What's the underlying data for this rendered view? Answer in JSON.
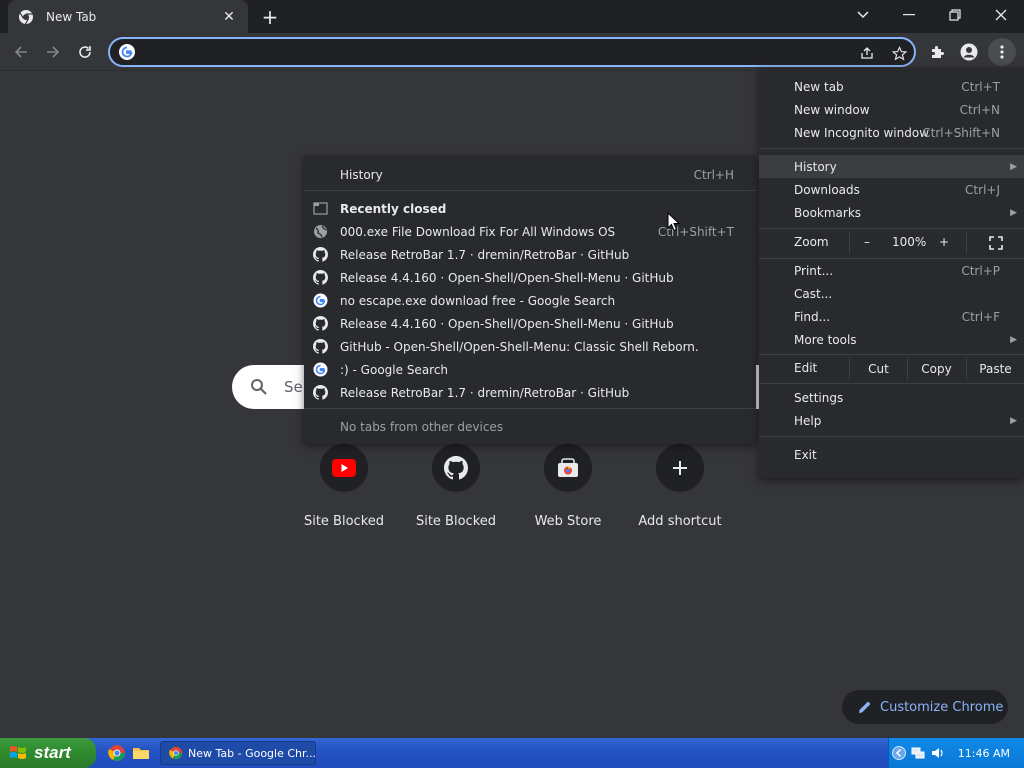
{
  "tab": {
    "title": "New Tab",
    "close": "✕"
  },
  "window": {
    "newtab": "+",
    "dropdown": "⌄",
    "minimize": "—",
    "restore": "❐",
    "close": "✕"
  },
  "omnibox": {
    "value": "",
    "placeholder": ""
  },
  "ntp": {
    "search_placeholder": "Se",
    "shortcuts": [
      {
        "label": "Site Blocked",
        "icon": "youtube-icon"
      },
      {
        "label": "Site Blocked",
        "icon": "github-icon"
      },
      {
        "label": "Web Store",
        "icon": "web-store-icon"
      },
      {
        "label": "Add shortcut",
        "icon": "plus-icon"
      }
    ],
    "customize_label": "Customize Chrome"
  },
  "menu": {
    "new_tab": {
      "label": "New tab",
      "shortcut": "Ctrl+T"
    },
    "new_window": {
      "label": "New window",
      "shortcut": "Ctrl+N"
    },
    "new_incognito": {
      "label": "New Incognito window",
      "shortcut": "Ctrl+Shift+N"
    },
    "history": {
      "label": "History"
    },
    "downloads": {
      "label": "Downloads",
      "shortcut": "Ctrl+J"
    },
    "bookmarks": {
      "label": "Bookmarks"
    },
    "zoom": {
      "label": "Zoom",
      "minus": "–",
      "value": "100%",
      "plus": "+"
    },
    "print": {
      "label": "Print...",
      "shortcut": "Ctrl+P"
    },
    "cast": {
      "label": "Cast..."
    },
    "find": {
      "label": "Find...",
      "shortcut": "Ctrl+F"
    },
    "more_tools": {
      "label": "More tools"
    },
    "edit": {
      "label": "Edit",
      "cut": "Cut",
      "copy": "Copy",
      "paste": "Paste"
    },
    "settings": {
      "label": "Settings"
    },
    "help": {
      "label": "Help"
    },
    "exit": {
      "label": "Exit"
    }
  },
  "history_menu": {
    "history": {
      "label": "History",
      "shortcut": "Ctrl+H"
    },
    "recently_closed": "Recently closed",
    "items": [
      {
        "label": "000.exe File Download  Fix For All Windows OS",
        "shortcut": "Ctrl+Shift+T",
        "icon": "globe-icon"
      },
      {
        "label": "Release RetroBar 1.7 · dremin/RetroBar · GitHub",
        "icon": "github-icon"
      },
      {
        "label": "Release 4.4.160 · Open-Shell/Open-Shell-Menu · GitHub",
        "icon": "github-icon"
      },
      {
        "label": "no escape.exe download free - Google Search",
        "icon": "google-icon"
      },
      {
        "label": "Release 4.4.160 · Open-Shell/Open-Shell-Menu · GitHub",
        "icon": "github-icon"
      },
      {
        "label": "GitHub - Open-Shell/Open-Shell-Menu: Classic Shell Reborn.",
        "icon": "github-icon"
      },
      {
        "label": ":) - Google Search",
        "icon": "google-icon"
      },
      {
        "label": "Release RetroBar 1.7 · dremin/RetroBar · GitHub",
        "icon": "github-icon"
      }
    ],
    "no_tabs": "No tabs from other devices"
  },
  "taskbar": {
    "start": "start",
    "task_label": "New Tab - Google Chr...",
    "clock": "11:46 AM"
  },
  "colors": {
    "accent": "#8ab4f8",
    "menu_bg": "#292a2d",
    "page_bg": "#35363a",
    "taskbar": "#2453c2",
    "start": "#2f8a2f"
  }
}
